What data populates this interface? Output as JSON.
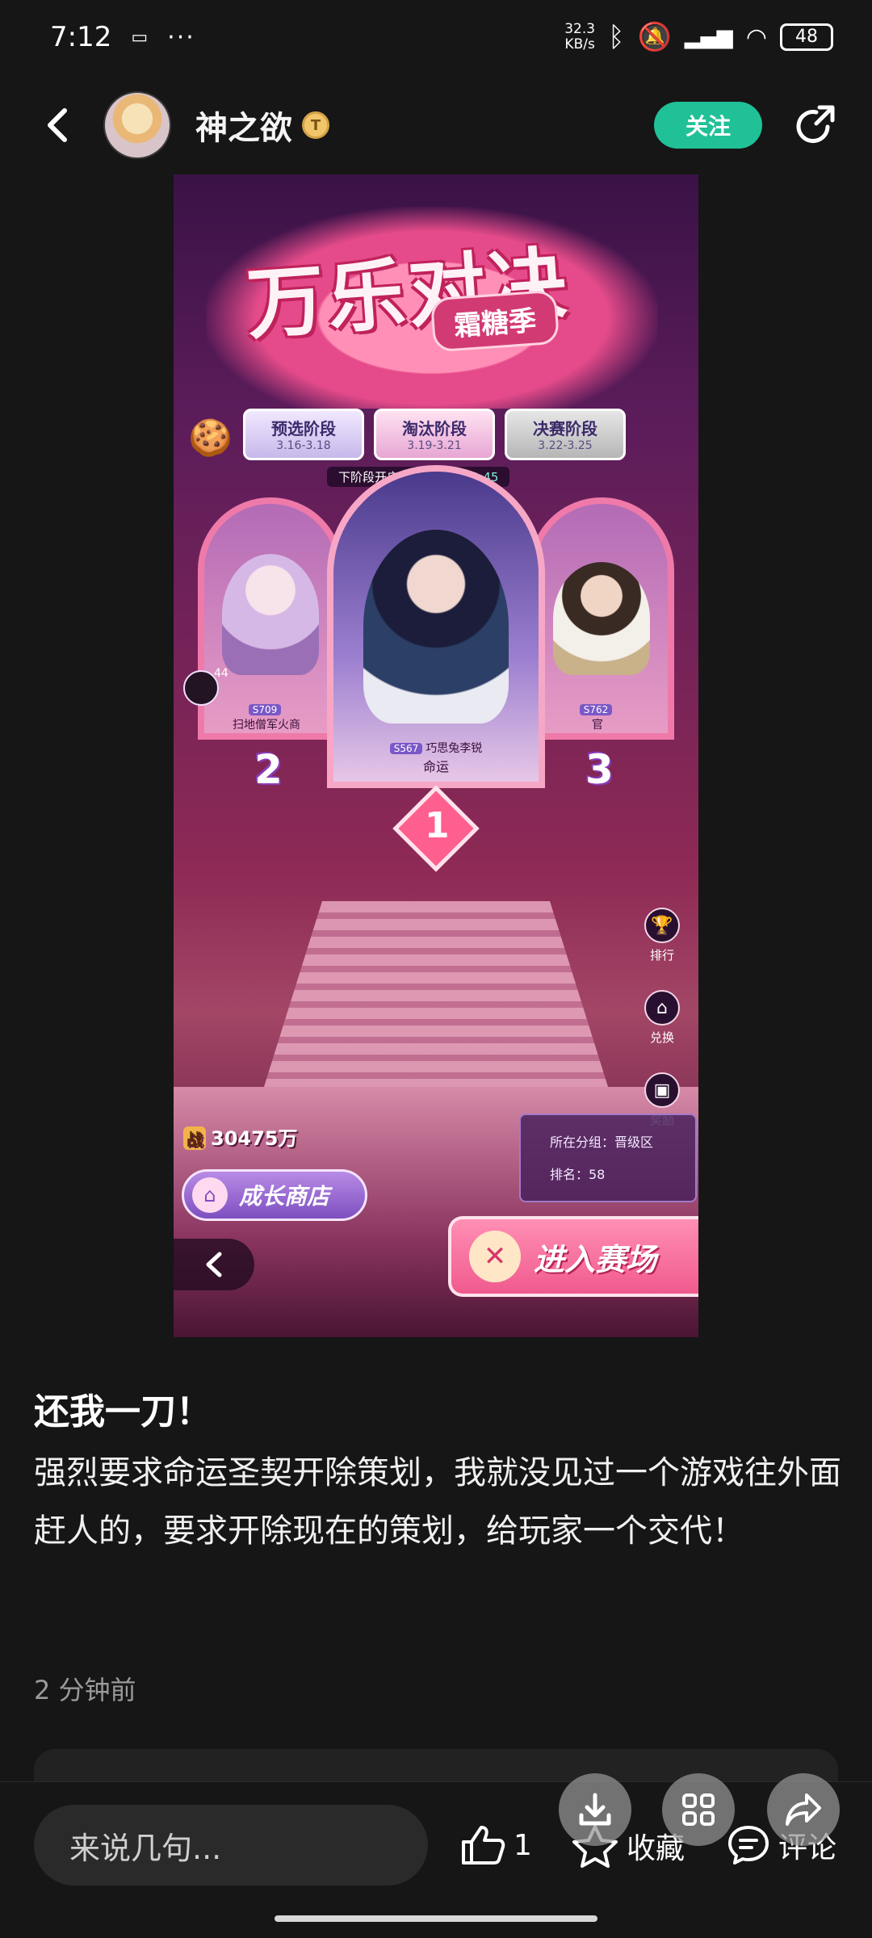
{
  "status_bar": {
    "time": "7:12",
    "notification_dots": "···",
    "net_speed": "32.3\nKB/s",
    "battery": "48"
  },
  "header": {
    "username": "神之欲",
    "follow_label": "关注"
  },
  "game": {
    "title": "万乐对决",
    "subtitle": "霜糖季",
    "stages": [
      {
        "name": "预选阶段",
        "date": "3.16-3.18"
      },
      {
        "name": "淘汰阶段",
        "date": "3.19-3.21"
      },
      {
        "name": "决赛阶段",
        "date": "3.22-3.25"
      }
    ],
    "countdown_label": "下阶段开启倒计时:",
    "countdown_value": "06:59:45",
    "players": [
      {
        "server": "S709",
        "name": "扫地僧军火商",
        "rank": "2"
      },
      {
        "server": "S567",
        "name": "巧思兔李锐",
        "title": "命运",
        "rank": "1"
      },
      {
        "server": "S762",
        "name": "官",
        "rank": "3"
      }
    ],
    "left_badge_count": "44",
    "side_menu": [
      "排行",
      "兑换",
      "奖励"
    ],
    "power_badge": "战",
    "power_value": "30475万",
    "group_label": "所在分组：晋级区",
    "rank_label": "排名：58",
    "shop_label": "成长商店",
    "enter_label": "进入赛场"
  },
  "post": {
    "title": "还我一刀！",
    "body": "强烈要求命运圣契开除策划，我就没见过一个游戏往外面赶人的，要求开除现在的策划，给玩家一个交代！",
    "time": "2 分钟前"
  },
  "bottom_bar": {
    "comment_placeholder": "来说几句...",
    "like_count": "1",
    "favorite_label": "收藏",
    "comment_label": "评论"
  },
  "colors": {
    "background": "#161616",
    "follow_button": "#20c197",
    "input_bg": "#2a2a2a"
  },
  "icons": [
    "back-arrow-icon",
    "verified-badge-icon",
    "share-out-icon",
    "download-icon",
    "grid-icon",
    "forward-icon",
    "thumbs-up-icon",
    "star-icon",
    "comment-bubble-icon"
  ]
}
